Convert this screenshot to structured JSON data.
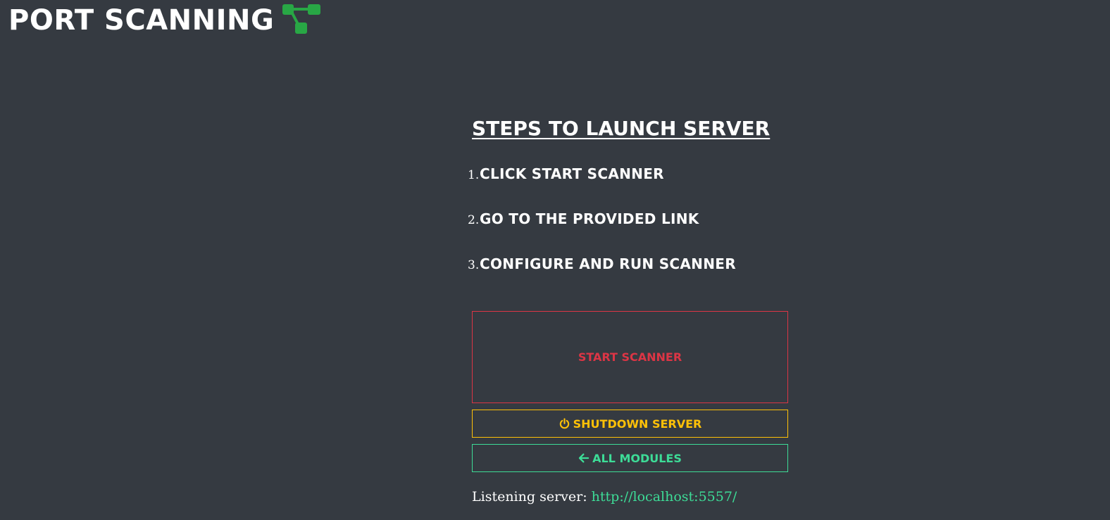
{
  "header": {
    "title": "PORT SCANNING",
    "logo_icon": "network-nodes-icon",
    "logo_color": "#28a745"
  },
  "steps": {
    "heading": "STEPS TO LAUNCH SERVER",
    "items": [
      {
        "number": "1.",
        "text": "CLICK START SCANNER"
      },
      {
        "number": "2.",
        "text": "GO TO THE PROVIDED LINK"
      },
      {
        "number": "3.",
        "text": "CONFIGURE AND RUN SCANNER"
      }
    ]
  },
  "buttons": {
    "start_label": "START SCANNER",
    "start_color": "#dc3545",
    "shutdown_label": "SHUTDOWN SERVER",
    "shutdown_icon": "power-icon",
    "shutdown_color": "#ffc107",
    "modules_label": "ALL MODULES",
    "modules_icon": "arrow-left-icon",
    "modules_color": "#3ddc97"
  },
  "footer": {
    "listening_label": "Listening server:",
    "listening_url": "http://localhost:5557/"
  }
}
